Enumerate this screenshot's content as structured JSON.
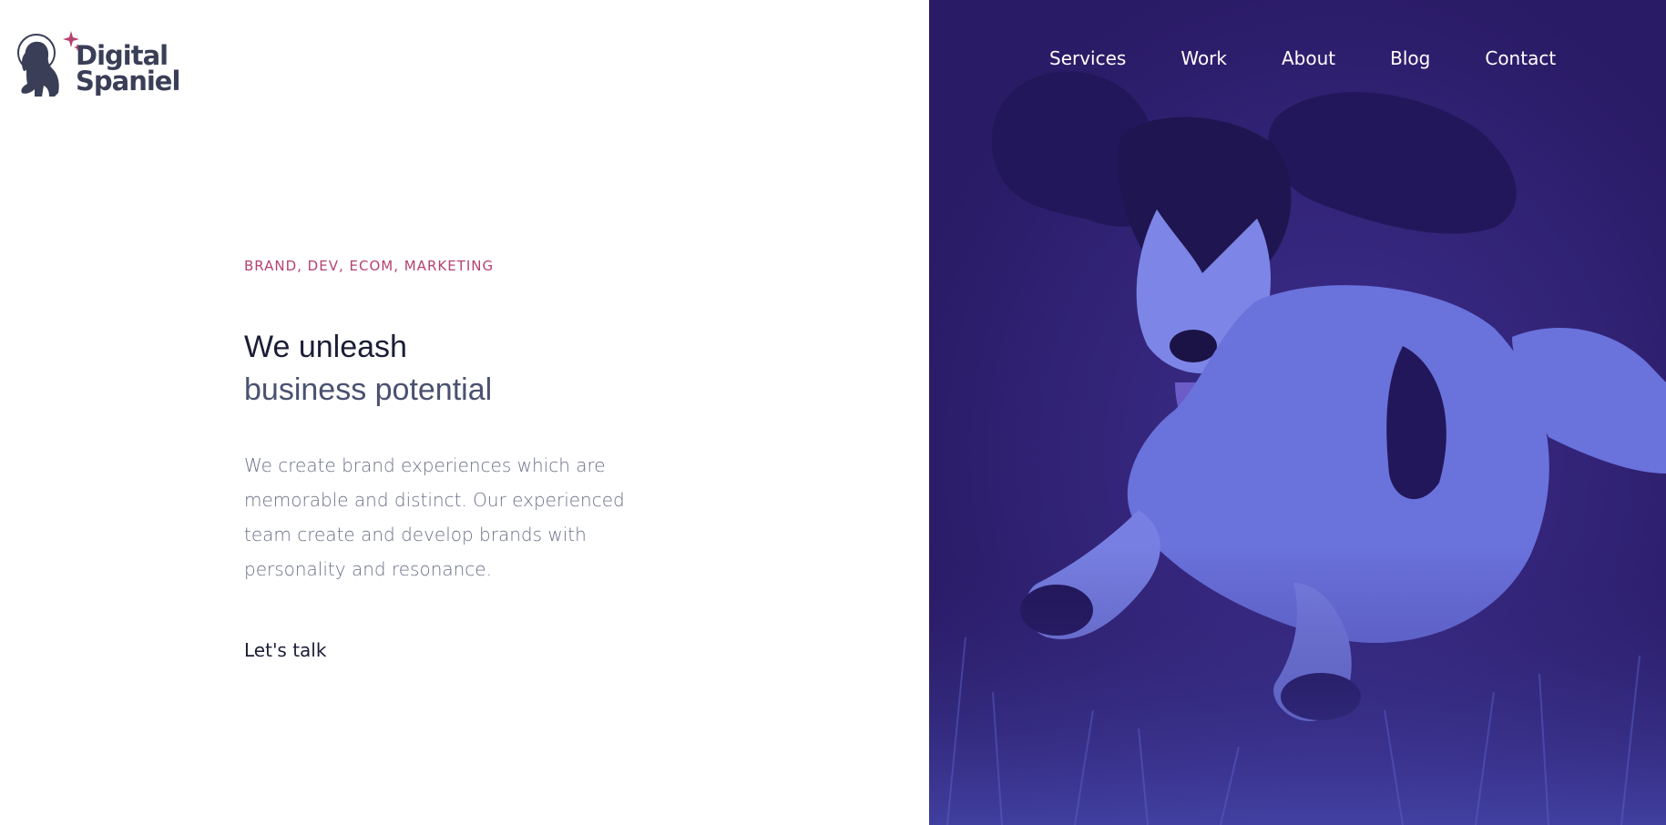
{
  "brand": {
    "name_line1": "Digital",
    "name_line2": "Spaniel",
    "logo_icon": "spaniel-astronaut-icon",
    "colors": {
      "text": "#3a3f57",
      "accent": "#b5426f"
    }
  },
  "nav": {
    "items": [
      {
        "label": "Services"
      },
      {
        "label": "Work"
      },
      {
        "label": "About"
      },
      {
        "label": "Blog"
      },
      {
        "label": "Contact"
      }
    ]
  },
  "hero": {
    "eyebrow": "BRAND, DEV, ECOM, MARKETING",
    "headline_line1": "We unleash",
    "headline_line2": "business potential",
    "body": "We create brand experiences which are memorable and distinct. Our experienced team create and develop brands with personality and resonance.",
    "cta_label": "Let's talk"
  },
  "image": {
    "subject": "spaniel-running-photo",
    "tint": "#2c1d6a"
  }
}
